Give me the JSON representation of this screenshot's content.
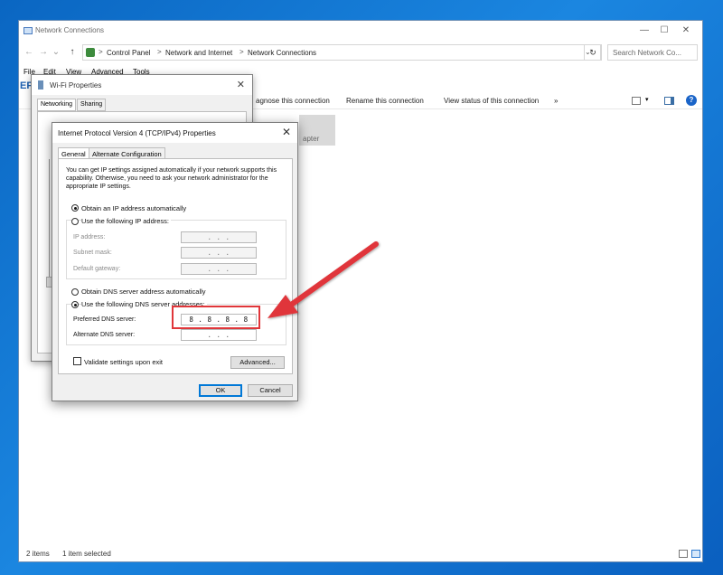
{
  "explorer": {
    "title": "Network Connections",
    "minimize": "—",
    "maximize": "☐",
    "close": "✕",
    "nav": {
      "back": "←",
      "forward": "→",
      "dropdown": "⌄",
      "up": "↑"
    },
    "breadcrumb": [
      "Control Panel",
      "Network and Internet",
      "Network Connections"
    ],
    "breadcrumb_sep": ">",
    "address_dropdown": "⌄",
    "refresh": "↻",
    "search_placeholder": "Search Network Co...",
    "menu": [
      "File",
      "Edit",
      "View",
      "Advanced",
      "Tools"
    ],
    "commands": [
      "agnose this connection",
      "Rename this connection",
      "View status of this connection",
      "»"
    ],
    "adapter_text": "apter",
    "status": {
      "items": "2 items",
      "selected": "1 item selected"
    }
  },
  "wifi": {
    "title": "Wi-Fi Properties",
    "close": "✕",
    "tabs": [
      "Networking",
      "Sharing"
    ]
  },
  "ipv4": {
    "title": "Internet Protocol Version 4 (TCP/IPv4) Properties",
    "close": "✕",
    "tabs": [
      "General",
      "Alternate Configuration"
    ],
    "intro": "You can get IP settings assigned automatically if your network supports this capability. Otherwise, you need to ask your network administrator for the appropriate IP settings.",
    "obtain_ip_auto": "Obtain an IP address automatically",
    "use_following_ip": "Use the following IP address:",
    "ip_address_label": "IP address:",
    "subnet_label": "Subnet mask:",
    "gateway_label": "Default gateway:",
    "empty_ip": ".   .   .",
    "obtain_dns_auto": "Obtain DNS server address automatically",
    "use_following_dns": "Use the following DNS server addresses:",
    "preferred_dns_label": "Preferred DNS server:",
    "preferred_dns_value": "8 . 8 . 8 . 8",
    "alternate_dns_label": "Alternate DNS server:",
    "alternate_dns_value": ".   .   .",
    "validate_label": "Validate settings upon exit",
    "advanced": "Advanced...",
    "ok": "OK",
    "cancel": "Cancel",
    "selected_ip_mode": "auto",
    "selected_dns_mode": "manual"
  },
  "annotation": {
    "arrow_color": "#e0363a"
  }
}
